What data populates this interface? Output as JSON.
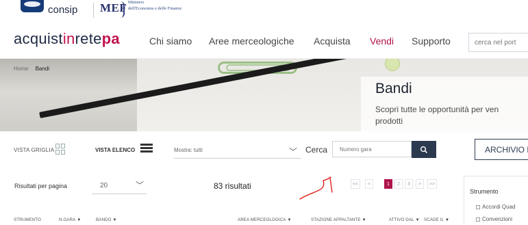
{
  "logos": {
    "consip_text": "consip",
    "mef_text": "MEF",
    "mef_small_line1": "Ministero",
    "mef_small_line2": "dell'Economia e delle Finanze"
  },
  "header": {
    "brand_parts": [
      "acquist",
      "in",
      "rete",
      "pa"
    ],
    "nav": [
      "Chi siamo",
      "Aree merceologiche",
      "Acquista",
      "Vendi",
      "Supporto"
    ],
    "active_nav": "Vendi",
    "search_placeholder": "cerca nel port"
  },
  "hero": {
    "breadcrumb": [
      "Home",
      "Bandi"
    ],
    "title": "Bandi",
    "subtitle_line1": "Scopri tutte le opportunità per ven",
    "subtitle_line2": "prodotti"
  },
  "controls": {
    "vista_griglia": "VISTA GRIGLIA",
    "vista_elenco": "VISTA ELENCO",
    "mostra": "Mostra: tutti",
    "cerca_label": "Cerca",
    "numero_gara_placeholder": "Numero gara",
    "search_icon": "magnifier-icon",
    "archivio": "ARCHIVIO B"
  },
  "results": {
    "per_page_label": "Risultati per pagina",
    "per_page_value": "20",
    "count": "83 risultati",
    "pager": [
      "<<",
      "<",
      "1",
      "2",
      "3",
      ">",
      ">>"
    ],
    "current_page": "1"
  },
  "filter_panel": {
    "title": "Strumento",
    "options": [
      "Accordi Quad",
      "Convenzioni"
    ]
  },
  "table_headers": [
    {
      "label": "STRUMENTO",
      "sortable": false
    },
    {
      "label": "N.GARA",
      "sortable": true
    },
    {
      "label": "BANDO",
      "sortable": true
    },
    {
      "label": "AREA MERCEOLOGICA",
      "sortable": true
    },
    {
      "label": "STAZIONE APPALTANTE",
      "sortable": true
    },
    {
      "label": "ATTIVO DAL",
      "sortable": true
    },
    {
      "label": "SCADE IL",
      "sortable": true
    }
  ],
  "colors": {
    "accent": "#b0144b",
    "dark": "#2b3a4f",
    "annotation": "#e0231b"
  }
}
